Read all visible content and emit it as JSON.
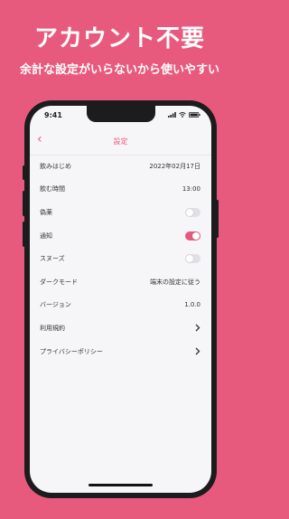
{
  "headline": "アカウント不要",
  "subhead": "余計な設定がいらないから使いやすい",
  "status": {
    "time": "9:41"
  },
  "nav": {
    "back_icon": "‹",
    "title": "設定"
  },
  "colors": {
    "accent": "#e85a7d",
    "toggle_off": "#e0e0e4"
  },
  "settings": [
    {
      "label": "飲みはじめ",
      "value": "2022年02月17日"
    },
    {
      "label": "飲む時間",
      "value": "13:00"
    },
    {
      "label": "偽薬",
      "toggle": false
    },
    {
      "label": "通知",
      "toggle": true
    },
    {
      "label": "スヌーズ",
      "toggle": false
    },
    {
      "label": "ダークモード",
      "value": "端末の設定に従う"
    },
    {
      "label": "バージョン",
      "value": "1.0.0"
    },
    {
      "label": "利用規約",
      "icon": "chevron-right-icon"
    },
    {
      "label": "プライバシーポリシー",
      "icon": "chevron-right-icon"
    }
  ]
}
